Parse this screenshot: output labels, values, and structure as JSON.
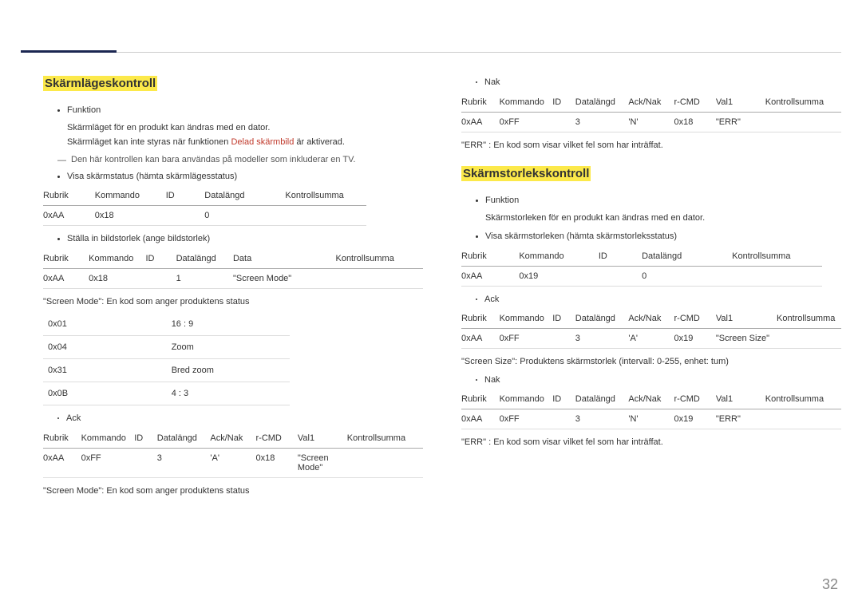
{
  "pageNumber": "32",
  "section1": {
    "title": "Skärmlägeskontroll",
    "funcLabel": "Funktion",
    "funcText": "Skärmläget för en produkt kan ändras med en dator.",
    "warnPre": "Skärmläget kan inte styras när funktionen ",
    "warnRed": "Delad skärmbild",
    "warnPost": " är aktiverad.",
    "note": "Den här kontrollen kan bara användas på modeller som inkluderar en TV.",
    "b1": "Visa skärmstatus (hämta skärmlägesstatus)",
    "t1": {
      "h": [
        "Rubrik",
        "Kommando",
        "ID",
        "Datalängd",
        "Kontrollsumma"
      ],
      "r": [
        "0xAA",
        "0x18",
        "",
        "0",
        ""
      ]
    },
    "b2": "Ställa in bildstorlek (ange bildstorlek)",
    "t2": {
      "h": [
        "Rubrik",
        "Kommando",
        "ID",
        "Datalängd",
        "Data",
        "Kontrollsumma"
      ],
      "r": [
        "0xAA",
        "0x18",
        "",
        "1",
        "\"Screen Mode\"",
        ""
      ]
    },
    "desc1": "\"Screen Mode\": En kod som anger produktens status",
    "modes": [
      [
        "0x01",
        "16 : 9"
      ],
      [
        "0x04",
        "Zoom"
      ],
      [
        "0x31",
        "Bred zoom"
      ],
      [
        "0x0B",
        "4 : 3"
      ]
    ],
    "ackLabel": "Ack",
    "t3": {
      "h": [
        "Rubrik",
        "Kommando",
        "ID",
        "Datalängd",
        "Ack/Nak",
        "r-CMD",
        "Val1",
        "Kontrollsumma"
      ],
      "r": [
        "0xAA",
        "0xFF",
        "",
        "3",
        "'A'",
        "0x18",
        "\"Screen Mode\"",
        ""
      ]
    },
    "desc2": "\"Screen Mode\": En kod som anger produktens status",
    "nakLabel": "Nak",
    "t4": {
      "h": [
        "Rubrik",
        "Kommando",
        "ID",
        "Datalängd",
        "Ack/Nak",
        "r-CMD",
        "Val1",
        "Kontrollsumma"
      ],
      "r": [
        "0xAA",
        "0xFF",
        "",
        "3",
        "'N'",
        "0x18",
        "\"ERR\"",
        ""
      ]
    },
    "errDesc": "\"ERR\" : En kod som visar vilket fel som har inträffat."
  },
  "section2": {
    "title": "Skärmstorlekskontroll",
    "funcLabel": "Funktion",
    "funcText": "Skärmstorleken för en produkt kan ändras med en dator.",
    "b1": "Visa skärmstorleken (hämta skärmstorleksstatus)",
    "t1": {
      "h": [
        "Rubrik",
        "Kommando",
        "ID",
        "Datalängd",
        "Kontrollsumma"
      ],
      "r": [
        "0xAA",
        "0x19",
        "",
        "0",
        ""
      ]
    },
    "ackLabel": "Ack",
    "t2": {
      "h": [
        "Rubrik",
        "Kommando",
        "ID",
        "Datalängd",
        "Ack/Nak",
        "r-CMD",
        "Val1",
        "Kontrollsumma"
      ],
      "r": [
        "0xAA",
        "0xFF",
        "",
        "3",
        "'A'",
        "0x19",
        "\"Screen Size\"",
        ""
      ]
    },
    "desc1": "\"Screen Size\": Produktens skärmstorlek (intervall: 0-255, enhet: tum)",
    "nakLabel": "Nak",
    "t3": {
      "h": [
        "Rubrik",
        "Kommando",
        "ID",
        "Datalängd",
        "Ack/Nak",
        "r-CMD",
        "Val1",
        "Kontrollsumma"
      ],
      "r": [
        "0xAA",
        "0xFF",
        "",
        "3",
        "'N'",
        "0x19",
        "\"ERR\"",
        ""
      ]
    },
    "errDesc": "\"ERR\" : En kod som visar vilket fel som har inträffat."
  }
}
